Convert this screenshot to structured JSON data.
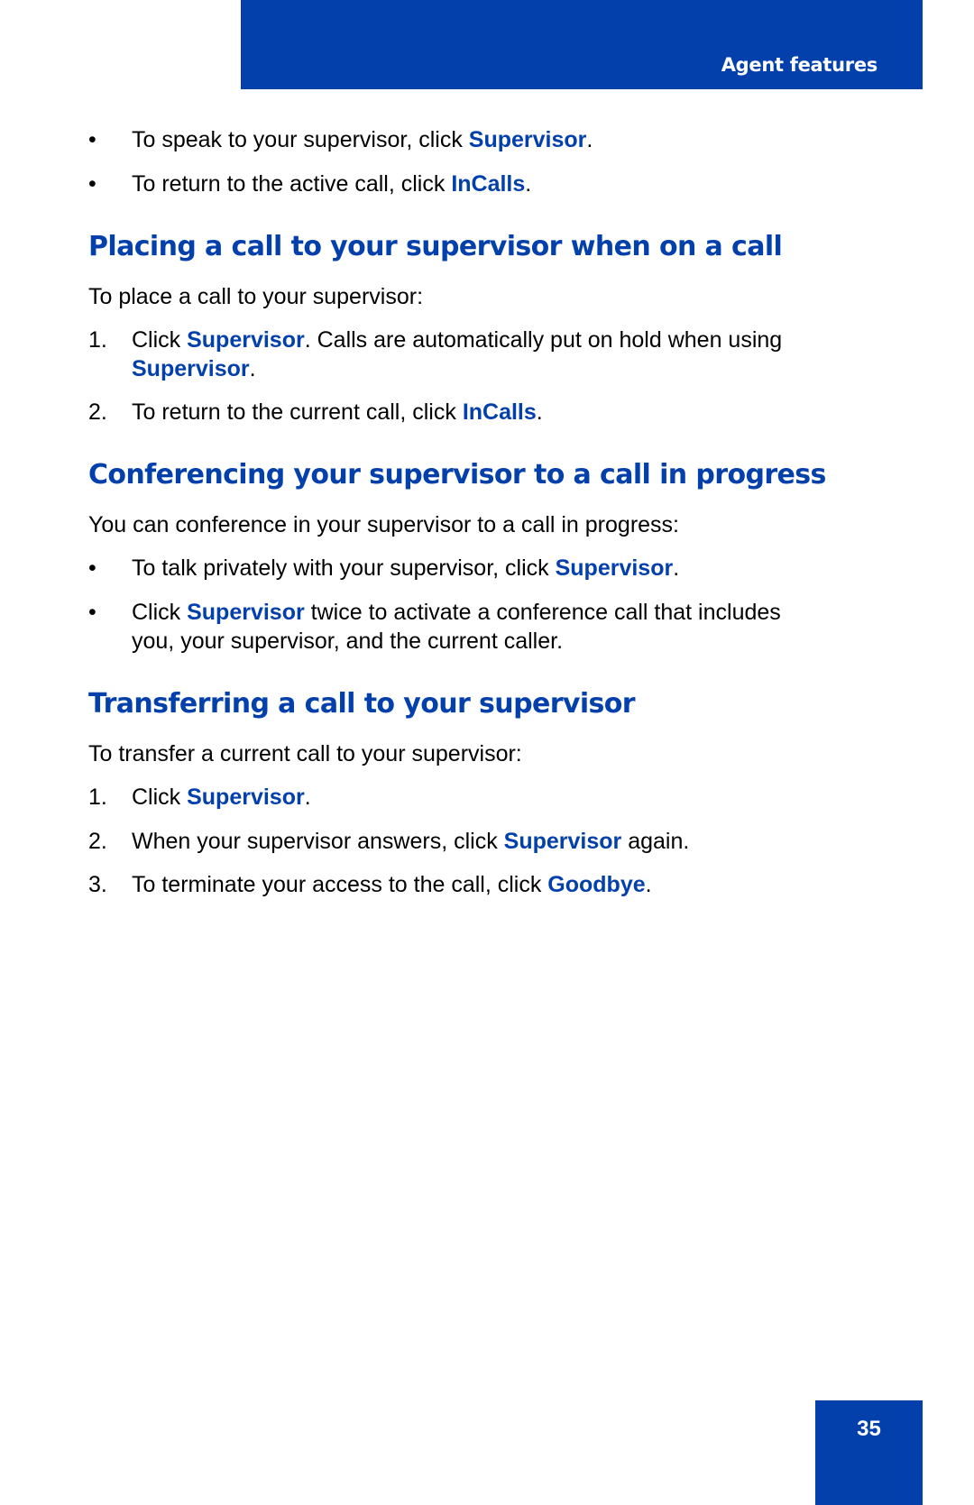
{
  "header": {
    "section_title": "Agent features"
  },
  "intro_bullets": [
    {
      "marker": "•",
      "pre": "To speak to your supervisor, click ",
      "kw": "Supervisor",
      "post": "."
    },
    {
      "marker": "•",
      "pre": "To return to the active call, click ",
      "kw": "InCalls",
      "post": "."
    }
  ],
  "sections": [
    {
      "heading": "Placing a call to your supervisor when on a call",
      "intro": "To place a call to your supervisor:",
      "items": [
        {
          "marker": "1.",
          "pre": "Click ",
          "kw": "Supervisor",
          "post": ". Calls are automatically put on hold when using",
          "line2_kw": "Supervisor",
          "line2_post": "."
        },
        {
          "marker": "2.",
          "pre": "To return to the current call, click ",
          "kw": "InCalls",
          "post": "."
        }
      ]
    },
    {
      "heading": "Conferencing your supervisor to a call in progress",
      "intro": "You can conference in your supervisor to a call in progress:",
      "items": [
        {
          "marker": "•",
          "pre": "To talk privately with your supervisor, click ",
          "kw": "Supervisor",
          "post": "."
        },
        {
          "marker": "•",
          "pre": "Click ",
          "kw": "Supervisor",
          "post": " twice to activate a conference call that includes",
          "line2": "you, your supervisor, and the current caller."
        }
      ]
    },
    {
      "heading": "Transferring a call to your supervisor",
      "intro": "To transfer a current call to your supervisor:",
      "items": [
        {
          "marker": "1.",
          "pre": "Click ",
          "kw": "Supervisor",
          "post": "."
        },
        {
          "marker": "2.",
          "pre": "When your supervisor answers, click ",
          "kw": "Supervisor",
          "post": " again."
        },
        {
          "marker": "3.",
          "pre": "To terminate your access to the call, click ",
          "kw": "Goodbye",
          "post": "."
        }
      ]
    }
  ],
  "footer": {
    "page_number": "35"
  },
  "colors": {
    "brand_blue": "#0340ac"
  }
}
